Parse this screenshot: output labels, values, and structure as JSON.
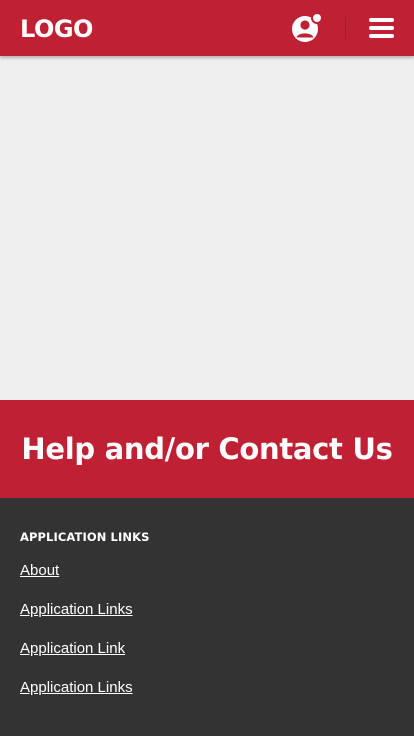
{
  "header": {
    "logo_text": "LOGO",
    "background_color": "#c02033",
    "profile_icon": "user-profile-notification-icon",
    "menu_icon": "hamburger-menu-icon"
  },
  "content": {
    "background_color": "#efefef"
  },
  "help_band": {
    "title": "Help and/or Contact Us",
    "background_color": "#c02033"
  },
  "footer": {
    "background_color": "#333333",
    "heading": "APPLICATION LINKS",
    "links": [
      {
        "label": "About"
      },
      {
        "label": "Application Links"
      },
      {
        "label": "Application Link"
      },
      {
        "label": "Application Links"
      }
    ]
  }
}
